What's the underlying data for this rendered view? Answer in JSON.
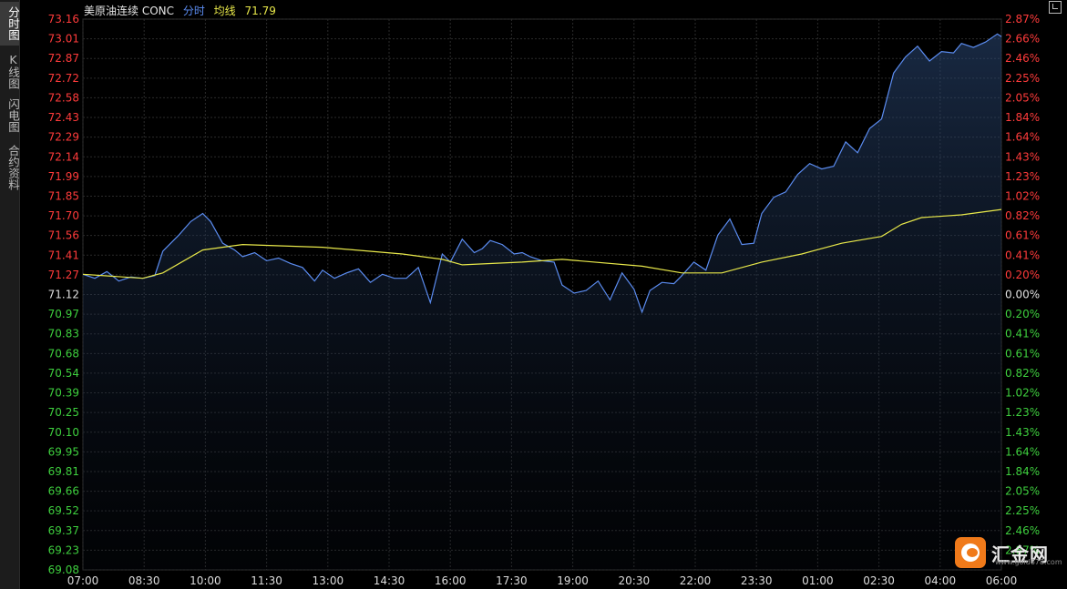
{
  "sidebar": {
    "tabs": [
      {
        "label": "分时图",
        "active": true
      },
      {
        "label": "K线图",
        "active": false
      },
      {
        "label": "闪电图",
        "active": false
      },
      {
        "label": "合约资料",
        "active": false
      }
    ]
  },
  "header": {
    "symbol": "美原油连续 CONC",
    "time_label": "分时",
    "avg_label": "均线",
    "avg_value": "71.79"
  },
  "logo": {
    "name": "汇金网",
    "url": "www.gold678.com"
  },
  "colors": {
    "price_line": "#5b8cf0",
    "avg_line": "#e8e84a",
    "up": "#ff3b3b",
    "down": "#3ecf3e",
    "flat": "#e0e0e0"
  },
  "chart_data": {
    "type": "line",
    "title": "美原油连续 CONC",
    "xlabel": "",
    "ylabel": "",
    "base_price": 71.12,
    "ylim": [
      69.08,
      73.16
    ],
    "y_ticks": [
      "73.16",
      "73.01",
      "72.87",
      "72.72",
      "72.58",
      "72.43",
      "72.29",
      "72.14",
      "71.99",
      "71.85",
      "71.70",
      "71.56",
      "71.41",
      "71.27",
      "71.12",
      "70.97",
      "70.83",
      "70.68",
      "70.54",
      "70.39",
      "70.25",
      "70.10",
      "69.95",
      "69.81",
      "69.66",
      "69.52",
      "69.37",
      "69.23",
      "69.08"
    ],
    "pct_ticks": [
      "2.87%",
      "2.66%",
      "2.46%",
      "2.25%",
      "2.05%",
      "1.84%",
      "1.64%",
      "1.43%",
      "1.23%",
      "1.02%",
      "0.82%",
      "0.61%",
      "0.41%",
      "0.20%",
      "0.00%",
      "0.20%",
      "0.41%",
      "0.61%",
      "0.82%",
      "1.02%",
      "1.23%",
      "1.43%",
      "1.64%",
      "1.84%",
      "2.05%",
      "2.25%",
      "2.46%",
      "2.87%"
    ],
    "x_ticks": [
      "07:00",
      "08:30",
      "10:00",
      "11:30",
      "13:00",
      "14:30",
      "16:00",
      "17:30",
      "19:00",
      "20:30",
      "22:00",
      "23:30",
      "01:00",
      "02:30",
      "04:00",
      "06:00"
    ],
    "x_range_hours": [
      0,
      23
    ],
    "grid": true,
    "series": [
      {
        "name": "分时",
        "hours": [
          0,
          0.3,
          0.6,
          0.9,
          1.2,
          1.5,
          1.8,
          2.0,
          2.1,
          2.4,
          2.7,
          3.0,
          3.2,
          3.5,
          3.8,
          4.0,
          4.3,
          4.6,
          4.9,
          5.2,
          5.5,
          5.8,
          6.0,
          6.3,
          6.6,
          6.9,
          7.2,
          7.5,
          7.8,
          8.1,
          8.4,
          8.7,
          9.0,
          9.2,
          9.5,
          9.8,
          10.0,
          10.2,
          10.5,
          10.8,
          11.0,
          11.2,
          11.5,
          11.8,
          12.0,
          12.3,
          12.6,
          12.9,
          13.2,
          13.5,
          13.8,
          14.0,
          14.2,
          14.5,
          14.8,
          15.0,
          15.3,
          15.6,
          15.9,
          16.2,
          16.5,
          16.8,
          17.0,
          17.3,
          17.6,
          17.9,
          18.2,
          18.5,
          18.8,
          19.1,
          19.4,
          19.7,
          20.0,
          20.3,
          20.6,
          20.9,
          21.2,
          21.5,
          21.8,
          22.0,
          22.3,
          22.6,
          22.9,
          23.0
        ],
        "values": [
          71.27,
          71.24,
          71.29,
          71.22,
          71.25,
          71.24,
          71.26,
          71.44,
          71.47,
          71.56,
          71.66,
          71.72,
          71.66,
          71.5,
          71.45,
          71.4,
          71.43,
          71.37,
          71.39,
          71.35,
          71.32,
          71.22,
          71.3,
          71.24,
          71.28,
          71.31,
          71.21,
          71.27,
          71.24,
          71.24,
          71.32,
          71.06,
          71.42,
          71.36,
          71.53,
          71.43,
          71.46,
          71.52,
          71.49,
          71.42,
          71.43,
          71.4,
          71.37,
          71.36,
          71.19,
          71.13,
          71.15,
          71.22,
          71.08,
          71.28,
          71.16,
          70.99,
          71.15,
          71.21,
          71.2,
          71.26,
          71.36,
          71.3,
          71.56,
          71.68,
          71.49,
          71.5,
          71.72,
          71.84,
          71.88,
          72.01,
          72.09,
          72.05,
          72.07,
          72.25,
          72.17,
          72.35,
          72.42,
          72.76,
          72.88,
          72.96,
          72.85,
          72.92,
          72.91,
          72.98,
          72.95,
          72.99,
          73.05,
          73.03
        ]
      },
      {
        "name": "均线",
        "hours": [
          0,
          1.5,
          2.0,
          3.0,
          4.0,
          6.0,
          8.0,
          9.0,
          9.5,
          11.0,
          12.0,
          14.0,
          15.0,
          16.0,
          17.0,
          18.0,
          19.0,
          20.0,
          20.5,
          21.0,
          22.0,
          23.0
        ],
        "values": [
          71.27,
          71.24,
          71.28,
          71.45,
          71.49,
          71.47,
          71.42,
          71.38,
          71.34,
          71.36,
          71.38,
          71.33,
          71.28,
          71.28,
          71.36,
          71.42,
          71.5,
          71.55,
          71.64,
          71.69,
          71.71,
          71.75
        ]
      }
    ]
  }
}
